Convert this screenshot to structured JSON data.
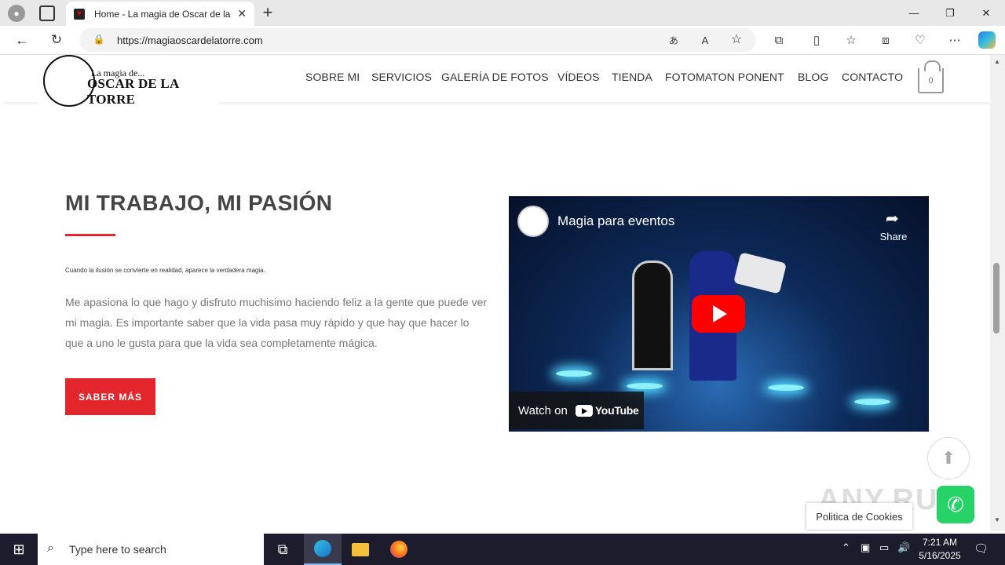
{
  "browser": {
    "tab_title": "Home - La magia de Oscar de la",
    "url": "https://magiaoscardelatorre.com",
    "new_tab_label": "+",
    "tab_close": "✕"
  },
  "header": {
    "logo_small": "La magia de...",
    "logo_big": "OSCAR DE LA TORRE",
    "nav": [
      "SOBRE MI",
      "SERVICIOS",
      "GALERÍA DE FOTOS",
      "VÍDEOS",
      "TIENDA",
      "FOTOMATON PONENT",
      "BLOG",
      "CONTACTO"
    ],
    "cart_count": "0"
  },
  "main": {
    "heading": "MI TRABAJO, MI PASIÓN",
    "tagline": "Cuando la ilusión se convierte en realidad, aparece la verdadera magia.",
    "paragraph": "Me apasiona lo que hago y disfruto muchisimo haciendo feliz a la gente que puede ver mi magia. Es importante saber que la vida pasa muy rápido y que hay que hacer lo que a uno le gusta para que la vida sea completamente mágica.",
    "button": "SABER MÁS"
  },
  "video": {
    "title": "Magia para eventos",
    "share": "Share",
    "watch_on": "Watch on",
    "youtube": "YouTube"
  },
  "cookies": "Politica de Cookies",
  "watermark": "ANY.RUN",
  "taskbar": {
    "search_placeholder": "Type here to search",
    "time": "7:21 AM",
    "date": "5/16/2025"
  }
}
